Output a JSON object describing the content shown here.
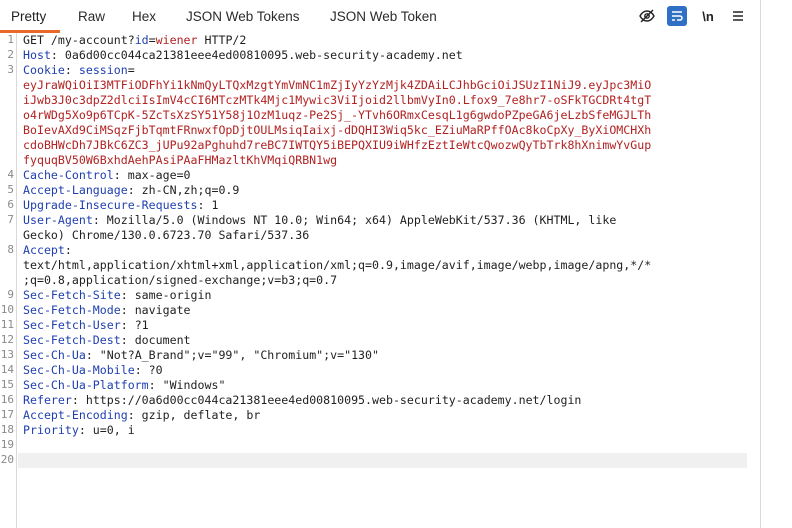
{
  "tabs": [
    "Pretty",
    "Raw",
    "Hex",
    "JSON Web Tokens",
    "JSON Web Token"
  ],
  "tools": {
    "hide_icon": "eye-slash-icon",
    "wrap_icon": "wrap-lines-icon",
    "newline_label": "\\n",
    "menu_icon": "hamburger-menu-icon"
  },
  "colors": {
    "header_name": "#1f3fb0",
    "value_red": "#b22222",
    "active_tab": "#e8692a",
    "wrap_toggle": "#2f6fc4"
  },
  "line_numbers": [
    "1",
    "2",
    "3",
    "4",
    "5",
    "6",
    "7",
    "8",
    "9",
    "10",
    "11",
    "12",
    "13",
    "14",
    "15",
    "16",
    "17",
    "18",
    "19",
    "20"
  ],
  "request": {
    "l1a": "GET /my-account?",
    "l1k": "id",
    "l1eq": "=",
    "l1v": "wiener",
    "l1b": " HTTP/2",
    "host_k": "Host",
    "host_v": ": 0a6d00cc044ca21381eee4ed00810095.web-security-academy.net",
    "cookie_k": "Cookie",
    "cookie_sep": ": ",
    "cookie_name": "session",
    "cookie_eq": "=",
    "cookie_1": "eyJraWQiOiI3MTFiODFhYi1kNmQyLTQxMzgtYmVmNC1mZjIyYzYzMjk4ZDAiLCJhbGciOiJSUzI1NiJ9.eyJpc3MiO",
    "cookie_2": "iJwb3J0c3dpZ2dlciIsImV4cCI6MTczMTk4Mjc1Mywic3ViIjoid2llbmVyIn0.Lfox9_7e8hr7-oSFkTGCDRt4tgT",
    "cookie_3": "o4rWDg5Xo9p6TCpK-5ZcTsXzSY51Y58j1OzM1uqz-Pe2Sj_-YTvh6ORmxCesqL1g6gwdoPZpeGA6jeLzbSfeMGJLTh",
    "cookie_4": "BoIevAXd9CiMSqzFjbTqmtFRnwxfOpDjtOULMsiqIaixj-dDQHI3Wiq5kc_EZiuMaRPffOAc8koCpXy_ByXiOMCHXh",
    "cookie_5": "cdoBHWcDh7JBkC6ZC3_jUPu92aPghuhd7reBC7IWTQY5iBEPQXIU9iWHfzEztIeWtcQwozwQyTbTrk8hXnimwYvGup",
    "cookie_6": "fyquqBV50W6BxhdAehPAsiPAaFHMazltKhVMqiQRBN1wg",
    "h4_k": "Cache-Control",
    "h4_v": ": max-age=0",
    "h5_k": "Accept-Language",
    "h5_v": ": zh-CN,zh;q=0.9",
    "h6_k": "Upgrade-Insecure-Requests",
    "h6_v": ": 1",
    "h7_k": "User-Agent",
    "h7_v": ": Mozilla/5.0 (Windows NT 10.0; Win64; x64) AppleWebKit/537.36 (KHTML, like",
    "h7_v2": "Gecko) Chrome/130.0.6723.70 Safari/537.36",
    "h8_k": "Accept",
    "h8_v": ":",
    "h8_v2": "text/html,application/xhtml+xml,application/xml;q=0.9,image/avif,image/webp,image/apng,*/*",
    "h8_v3": ";q=0.8,application/signed-exchange;v=b3;q=0.7",
    "h9_k": "Sec-Fetch-Site",
    "h9_v": ": same-origin",
    "h10_k": "Sec-Fetch-Mode",
    "h10_v": ": navigate",
    "h11_k": "Sec-Fetch-User",
    "h11_v": ": ?1",
    "h12_k": "Sec-Fetch-Dest",
    "h12_v": ": document",
    "h13_k": "Sec-Ch-Ua",
    "h13_v": ": \"Not?A_Brand\";v=\"99\", \"Chromium\";v=\"130\"",
    "h14_k": "Sec-Ch-Ua-Mobile",
    "h14_v": ": ?0",
    "h15_k": "Sec-Ch-Ua-Platform",
    "h15_v": ": \"Windows\"",
    "h16_k": "Referer",
    "h16_v": ": https://0a6d00cc044ca21381eee4ed00810095.web-security-academy.net/login",
    "h17_k": "Accept-Encoding",
    "h17_v": ": gzip, deflate, br",
    "h18_k": "Priority",
    "h18_v": ": u=0, i"
  }
}
